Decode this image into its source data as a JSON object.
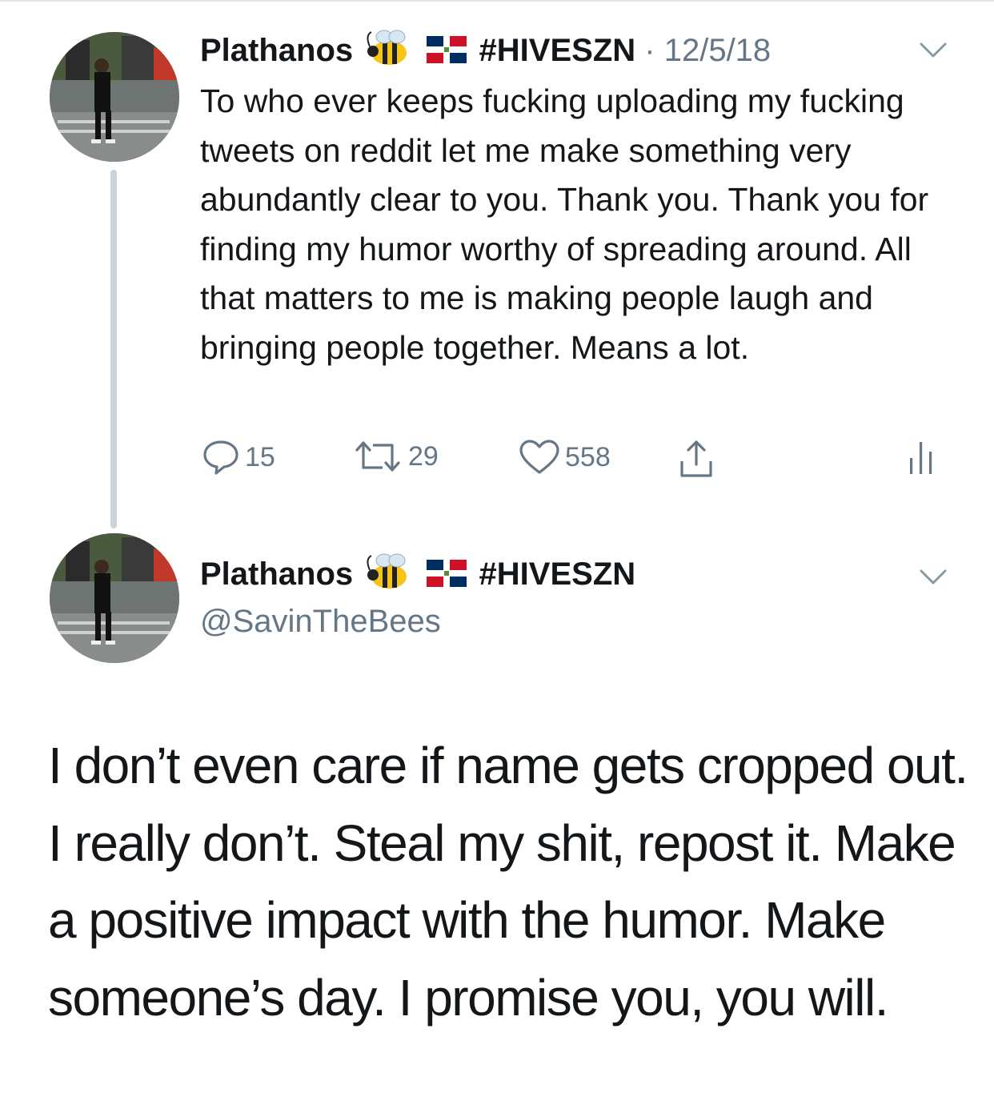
{
  "tweet1": {
    "display_name": "Plathanos",
    "hashtag": "#HIVESZN",
    "separator": "·",
    "date": "12/5/18",
    "text": "To who ever keeps fucking uploading my fucking tweets on reddit let me make something very abundantly clear to you. Thank you. Thank you for finding my humor worthy of spreading around. All that matters to me is making people laugh and bringing people together. Means a lot.",
    "replies": "15",
    "retweets": "29",
    "likes": "558"
  },
  "tweet2": {
    "display_name": "Plathanos",
    "hashtag": "#HIVESZN",
    "handle": "@SavinTheBees",
    "text": "I don’t even care if name gets cropped out. I really don’t. Steal my shit, repost it. Make a positive impact with the humor. Make someone’s day. I promise you, you will."
  },
  "icons": [
    "bee-emoji",
    "dominican-flag-emoji",
    "chevron-down-icon",
    "reply-icon",
    "retweet-icon",
    "like-icon",
    "share-icon",
    "analytics-icon"
  ],
  "colors": {
    "text": "#14171a",
    "muted": "#657786",
    "thread_line": "#cbd3dc"
  }
}
